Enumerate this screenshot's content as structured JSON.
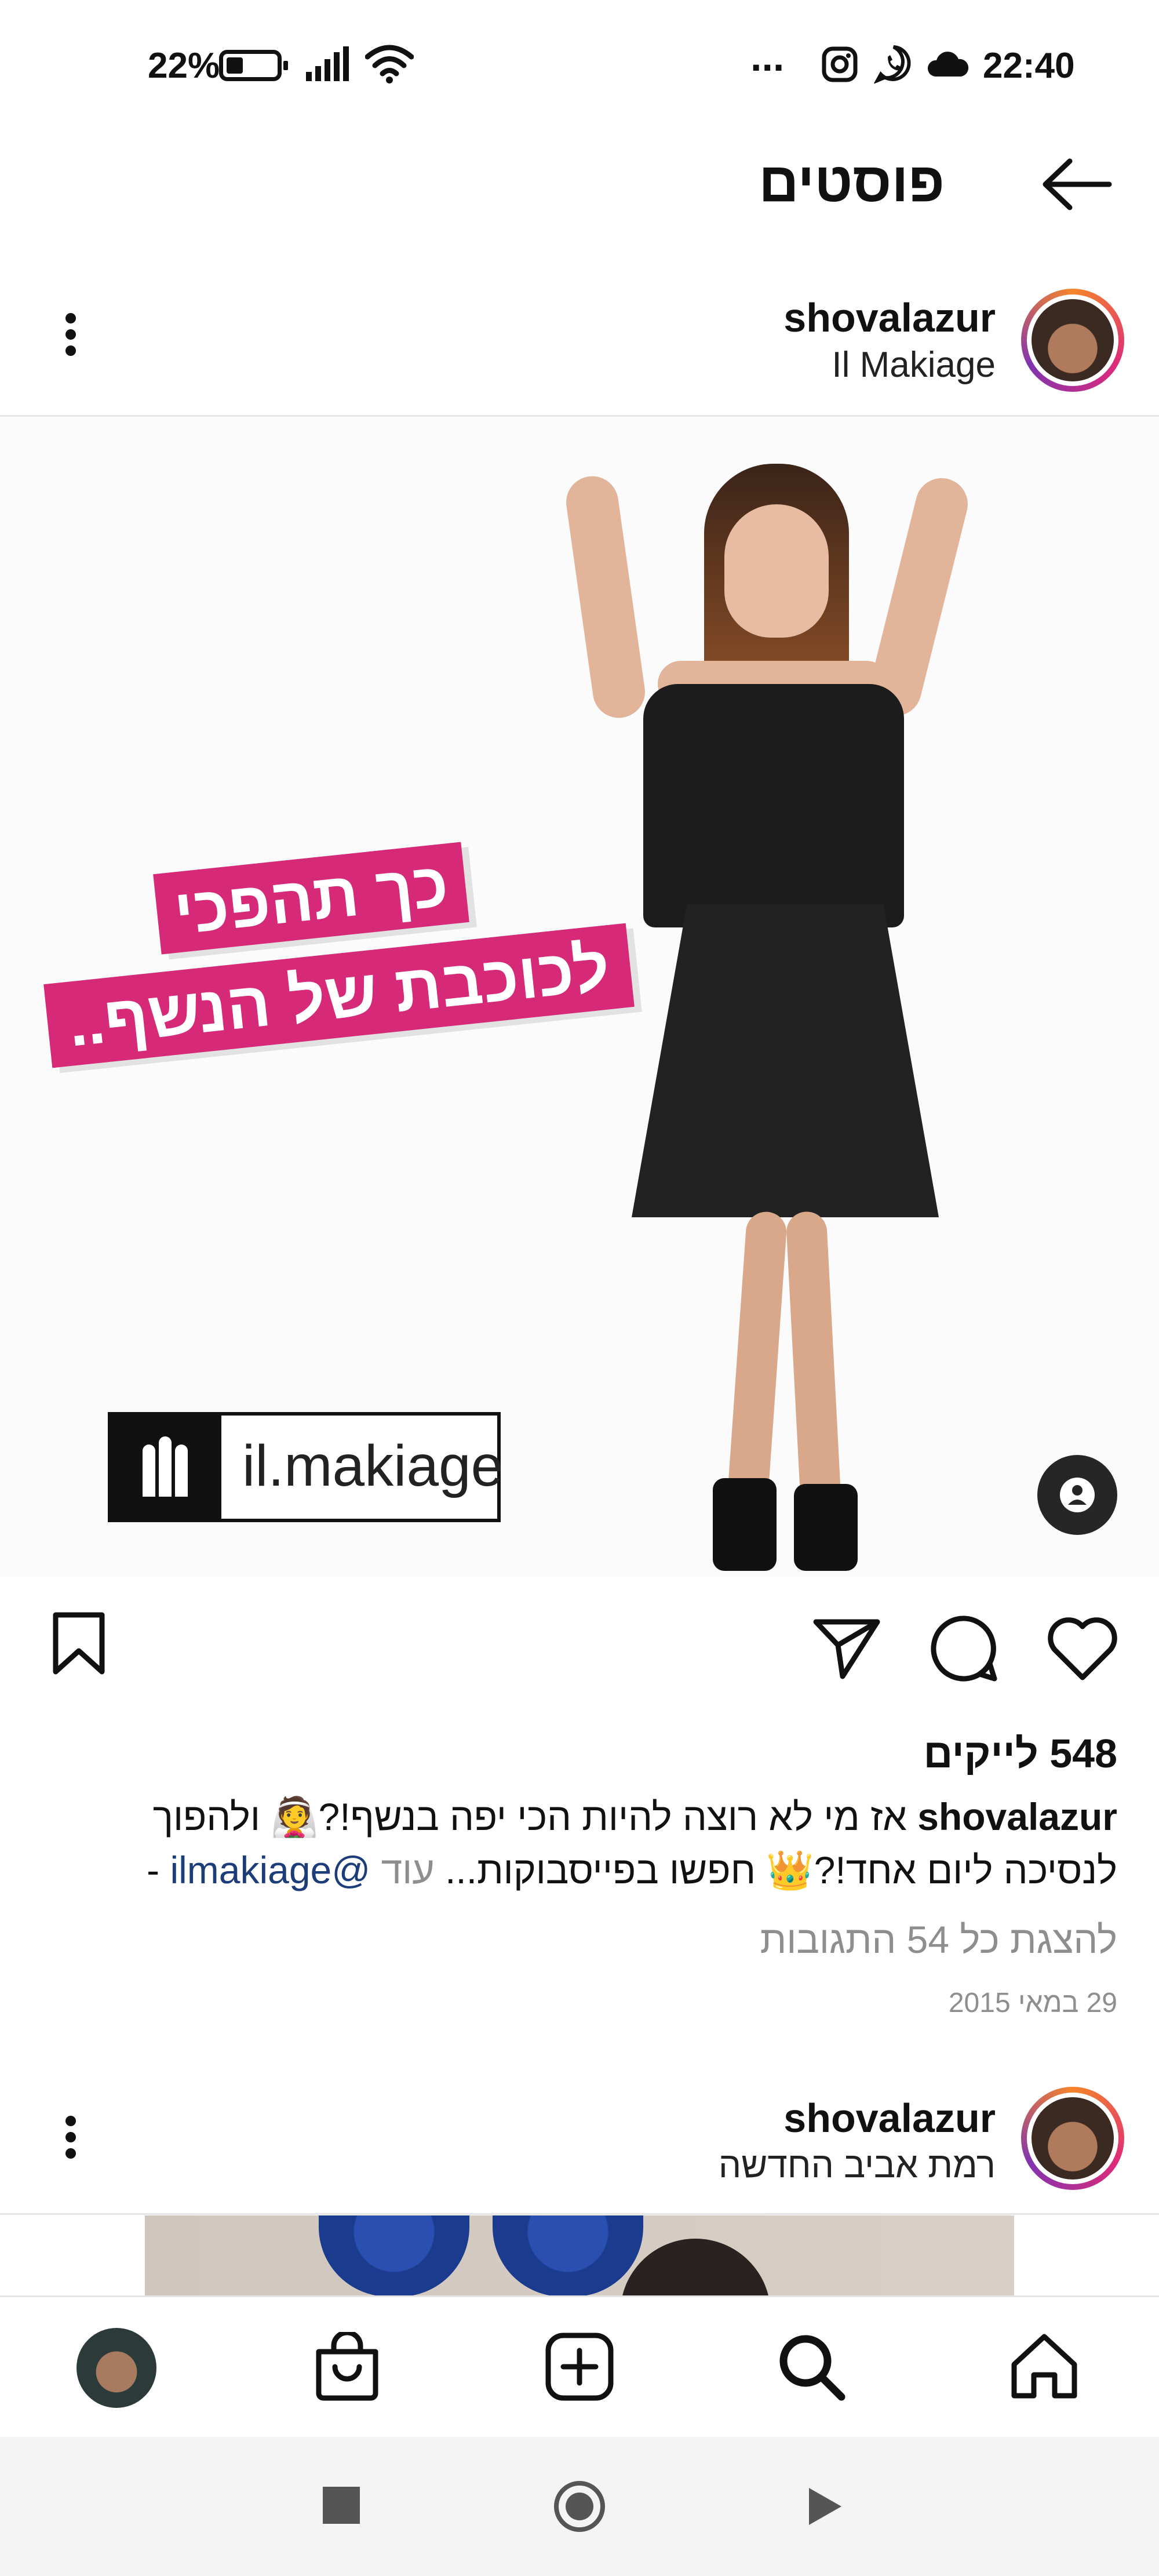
{
  "status_bar": {
    "battery": "22%",
    "time": "22:40",
    "more": "..."
  },
  "header": {
    "title": "פוסטים",
    "back_icon": "arrow-left-icon"
  },
  "post1": {
    "username": "shovalazur",
    "location": "Il Makiage",
    "promo_line1": "כך תהפכי",
    "promo_line2": "לכוכבת של הנשף..",
    "logo_text": "il.makiage",
    "likes": "548 לייקים",
    "caption_user": "shovalazur",
    "caption_line1": "אז מי לא רוצה להיות הכי יפה בנשף!?👰 ולהפוך",
    "caption_line2": "לנסיכה ליום אחד!?👑 חפשו בפייסבוקות...",
    "caption_more": "עוד",
    "caption_mention": "@ilmakiage",
    "caption_tail": "-",
    "comments_link": "להצגת כל 54 התגובות",
    "date": "29 במאי 2015"
  },
  "post2": {
    "username": "shovalazur",
    "location": "רמת אביב החדשה"
  },
  "bottom_nav": {
    "items": [
      "profile",
      "shop",
      "create",
      "search",
      "home"
    ]
  },
  "colors": {
    "brand_pink": "#d62a78",
    "mention_blue": "#1c3d7a",
    "muted": "#8e8e8e"
  }
}
